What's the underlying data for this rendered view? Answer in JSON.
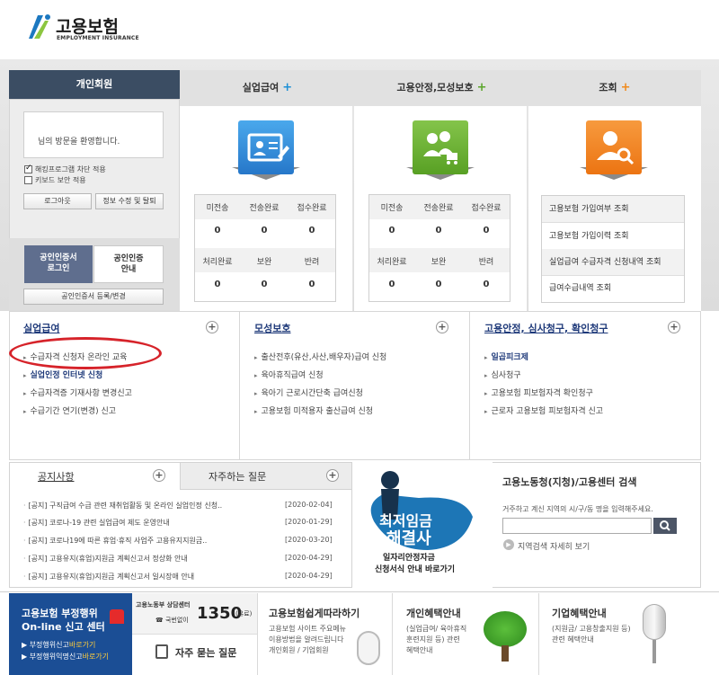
{
  "header": {
    "logo_text": "고용보험",
    "logo_sub": "EMPLOYMENT INSURANCE"
  },
  "login": {
    "tab_label": "개인회원",
    "welcome": "님의 방문을 환영합니다.",
    "check1": "해킹프로그램 차단 적용",
    "check2": "키보드 보안 적용",
    "logout": "로그아웃",
    "edit_info": "정보 수정 및 탈퇴",
    "cert_login": [
      "공인인증서",
      "로그인"
    ],
    "cert_info": [
      "공인인증",
      "안내"
    ],
    "cert_register": "공인인증서 등록/변경"
  },
  "tabs": [
    {
      "label": "실업급여",
      "plus": "+",
      "plus_color": "#1e90d6"
    },
    {
      "label": "고용안정,모성보호",
      "plus": "+",
      "plus_color": "#5aa52a"
    },
    {
      "label": "조회",
      "plus": "+",
      "plus_color": "#f08a1c"
    }
  ],
  "stats": {
    "headers_top": [
      "미전송",
      "전송완료",
      "접수완료"
    ],
    "headers_bottom": [
      "처리완료",
      "보완",
      "반려"
    ],
    "values_top": [
      "0",
      "0",
      "0"
    ],
    "values_bottom": [
      "0",
      "0",
      "0"
    ]
  },
  "lookup_items": [
    "고용보험 가입여부 조회",
    "고용보험 가입이력 조회",
    "실업급여 수급자격 신청내역 조회",
    "급여수급내역 조회"
  ],
  "menus": [
    {
      "title": "실업급여",
      "items": [
        "수급자격 신청자 온라인 교육",
        "실업인정 인터넷 신청",
        "수급자격증 기재사항 변경신고",
        "수급기간 연기(변경) 신고"
      ]
    },
    {
      "title": "모성보호",
      "items": [
        "출산전후(유산,사산,배우자)급여 신청",
        "육아휴직급여 신청",
        "육아기 근로시간단축 급여신청",
        "고용보험 미적용자 출산급여 신청"
      ]
    },
    {
      "title": "고용안정, 심사청구, 확인청구",
      "items": [
        "일곱피크제",
        "심사청구",
        "고용보험 피보험자격 확인청구",
        "근로자 고용보험 피보험자격 신고"
      ]
    }
  ],
  "notice": {
    "tab_notice": "공지사항",
    "tab_faq": "자주하는 질문",
    "rows": [
      {
        "text": "[공지] 구직급여 수급 관련 재취업활동 및 온라인 실업인정 신청..",
        "date": "[2020-02-04]"
      },
      {
        "text": "[공지] 코로나-19 관련 실업급여 제도 운영안내",
        "date": "[2020-01-29]"
      },
      {
        "text": "[공지] 코로나19에 따른 휴업·휴직 사업주 고용유지지원금..",
        "date": "[2020-03-20]"
      },
      {
        "text": "[공지] 고용유지(휴업)지원금 계획신고서 정상화 안내",
        "date": "[2020-04-29]"
      },
      {
        "text": "[공지] 고용유지(휴업)지원금 계획신고서 일시장애 안내",
        "date": "[2020-04-29]"
      }
    ]
  },
  "banner": {
    "title1": "최저임금",
    "title2": "해결사",
    "line1": "일자리안정자금",
    "line2": "신청서식 안내 바로가기"
  },
  "search": {
    "title": "고용노동청(지청)/고용센터 검색",
    "desc": "거주하고 계신 지역의 시/구/동 명을 입력해주세요.",
    "detail": "지역검색 자세히 보기"
  },
  "bottom": {
    "report_title1": "고용보험 부정행위",
    "report_title2": "On-line 신고 센터",
    "report_link1": "▶ 부정행위신고",
    "report_link1_b": "바로가기",
    "report_link2": "▶ 부정행위익명신고",
    "report_link2_b": "바로가기",
    "hotline_label": "고용노동부 상담센터",
    "hotline_number": "1350",
    "hotline_fee": "(유료)",
    "hotline_sub": "☎ 국번없이",
    "faq_label": "자주 묻는 질문",
    "easy_title": "고용보험쉽게따라하기",
    "easy_desc": [
      "고용보험 사이트 주요메뉴",
      "이용방법을 알려드립니다",
      "개인회원 / 기업회원"
    ],
    "personal_title": "개인혜택안내",
    "personal_desc": [
      "(실업급여/ 육아휴직",
      "훈련지원 등) 관련",
      "혜택안내"
    ],
    "company_title": "기업혜택안내",
    "company_desc": [
      "(지원금/ 고용창출지원 등)",
      "관련 혜택안내"
    ]
  },
  "colors": {
    "navy": "#3b4d63",
    "blue_icon": "#2f8fd9",
    "green_icon": "#69ae33",
    "orange_icon": "#f2841d",
    "menu_title": "#1f3a7a",
    "highlight_oval": "#d6232a",
    "report_bg": "#1b4e95"
  }
}
